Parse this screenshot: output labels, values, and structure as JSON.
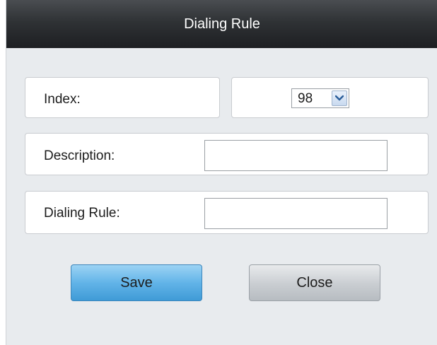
{
  "dialog": {
    "title": "Dialing Rule"
  },
  "form": {
    "index_label": "Index:",
    "index_value": "98",
    "description_label": "Description:",
    "description_value": "",
    "dialing_rule_label": "Dialing Rule:",
    "dialing_rule_value": ""
  },
  "buttons": {
    "save_label": "Save",
    "close_label": "Close"
  },
  "icons": {
    "dropdown": "chevron-down-icon"
  },
  "colors": {
    "title_bar": "#2f3235",
    "save_button": "#62b4e8",
    "close_button": "#c9cdd1",
    "background": "#e8ebee"
  }
}
